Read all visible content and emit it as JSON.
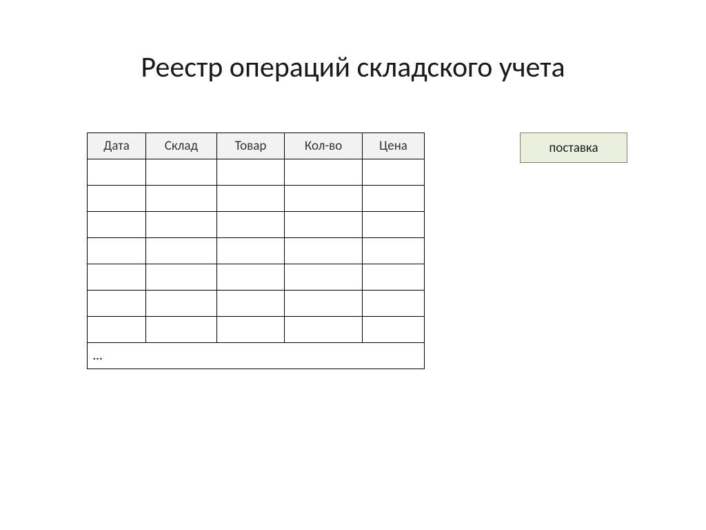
{
  "title": "Реестр операций складского учета",
  "table": {
    "headers": [
      "Дата",
      "Склад",
      "Товар",
      "Кол-во",
      "Цена"
    ],
    "empty_rows": 7,
    "ellipsis": "…"
  },
  "button": {
    "label": "поставка"
  }
}
